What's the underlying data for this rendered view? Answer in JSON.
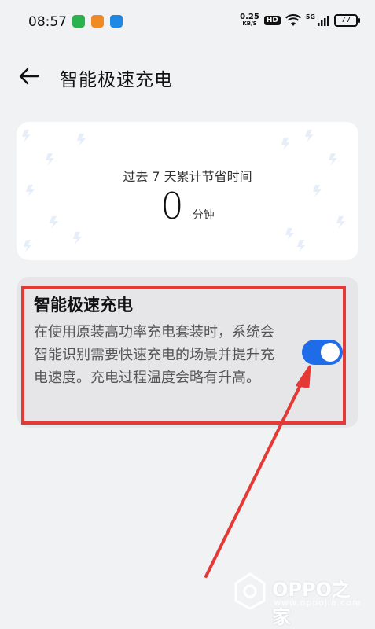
{
  "status_bar": {
    "time": "08:57",
    "net_speed_value": "0.25",
    "net_speed_unit": "KB/S",
    "hd_label": "HD",
    "network_label": "5G",
    "battery_level": "77"
  },
  "header": {
    "title": "智能极速充电"
  },
  "stats": {
    "label": "过去 7 天累计节省时间",
    "value": "0",
    "unit": "分钟"
  },
  "feature": {
    "title": "智能极速充电",
    "description": "在使用原装高功率充电套装时，系统会智能识别需要快速充电的场景并提升充电速度。充电过程温度会略有升高。",
    "toggle_on": true
  },
  "colors": {
    "accent": "#1f6ce8",
    "annotation": "#e53935"
  },
  "watermark": {
    "name": "OPPO之家",
    "url": "www.oppojia.com"
  }
}
